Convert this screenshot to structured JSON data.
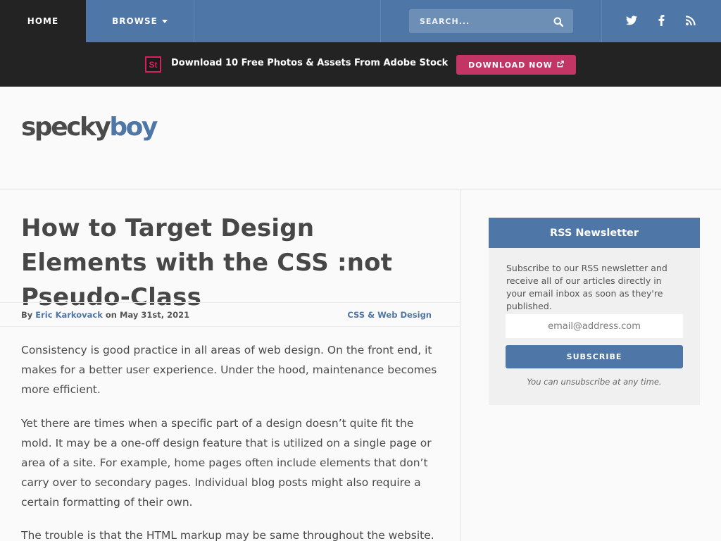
{
  "nav": {
    "home": "HOME",
    "browse": "BROWSE",
    "search_placeholder": "SEARCH...",
    "social_icons": [
      "twitter-icon",
      "facebook-icon",
      "rss-icon"
    ]
  },
  "promo": {
    "icon_text": "St",
    "text": "Download 10 Free Photos & Assets From Adobe Stock",
    "button": "DOWNLOAD NOW"
  },
  "logo": {
    "part1": "specky",
    "part2": "boy"
  },
  "article": {
    "title": "How to Target Design Elements with the CSS :not Pseudo-Class",
    "by_prefix": "By",
    "author": "Eric Karkovack",
    "date_prefix": "on",
    "date": "May 31st, 2021",
    "category": "CSS & Web Design",
    "paragraphs": [
      "Consistency is good practice in all areas of web design. On the front end, it makes for a better user experience. Under the hood, maintenance becomes more efficient.",
      "Yet there are times when a specific part of a design doesn’t quite fit the mold. It may be a one-off design feature that is utilized on a single page or area of a site. For example, home pages often include elements that don’t carry over to secondary pages. Individual blog posts might also require a certain formatting of their own.",
      "The trouble is that the HTML markup may be same throughout the website."
    ]
  },
  "sidebar": {
    "title": "RSS Newsletter",
    "description": "Subscribe to our RSS newsletter and receive all of our articles directly in your email inbox as soon as they're published.",
    "email_placeholder": "email@address.com",
    "button": "SUBSCRIBE",
    "note": "You can unsubscribe at any time."
  },
  "colors": {
    "brand_blue": "#4e76a6",
    "dark": "#232323",
    "promo_button": "#c33564"
  }
}
